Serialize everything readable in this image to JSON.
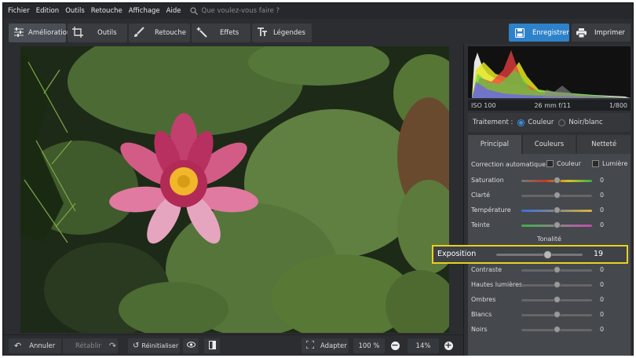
{
  "menu": [
    "Fichier",
    "Edition",
    "Outils",
    "Retouche",
    "Affichage",
    "Aide"
  ],
  "search": {
    "placeholder": "Que voulez-vous faire ?"
  },
  "tabs": [
    {
      "label": "Amélioration",
      "icon": "sliders-icon"
    },
    {
      "label": "Outils",
      "icon": "crop-icon"
    },
    {
      "label": "Retouche",
      "icon": "brush-icon"
    },
    {
      "label": "Effets",
      "icon": "magic-wand-icon"
    },
    {
      "label": "Légendes",
      "icon": "text-icon"
    }
  ],
  "actions": {
    "save": "Enregistrer",
    "print": "Imprimer"
  },
  "exif": {
    "iso": "ISO 100",
    "lens": "26 mm f/11",
    "shutter": "1/800"
  },
  "traitement": {
    "label": "Traitement :",
    "color": "Couleur",
    "bw": "Noir/blanc"
  },
  "panel_tabs": [
    "Principal",
    "Couleurs",
    "Netteté"
  ],
  "auto": {
    "label": "Correction automatique :",
    "color": "Couleur",
    "light": "Lumière"
  },
  "sliders_top": [
    {
      "label": "Saturation",
      "value": "0"
    },
    {
      "label": "Clarté",
      "value": "0"
    },
    {
      "label": "Température",
      "value": "0"
    },
    {
      "label": "Teinte",
      "value": "0"
    }
  ],
  "tonalite": "Tonalité",
  "exposure": {
    "label": "Exposition",
    "value": "19"
  },
  "sliders_bottom": [
    {
      "label": "Contraste",
      "value": "0"
    },
    {
      "label": "Hautes lumières",
      "value": "0"
    },
    {
      "label": "Ombres",
      "value": "0"
    },
    {
      "label": "Blancs",
      "value": "0"
    },
    {
      "label": "Noirs",
      "value": "0"
    }
  ],
  "bottom": {
    "undo": "Annuler",
    "redo": "Rétablir",
    "reset": "Réinitialiser",
    "fit": "Adapter",
    "zoom100": "100 %",
    "zoom": "14%"
  },
  "colors": {
    "accent": "#2e82c9",
    "highlight": "#e5d21f"
  }
}
